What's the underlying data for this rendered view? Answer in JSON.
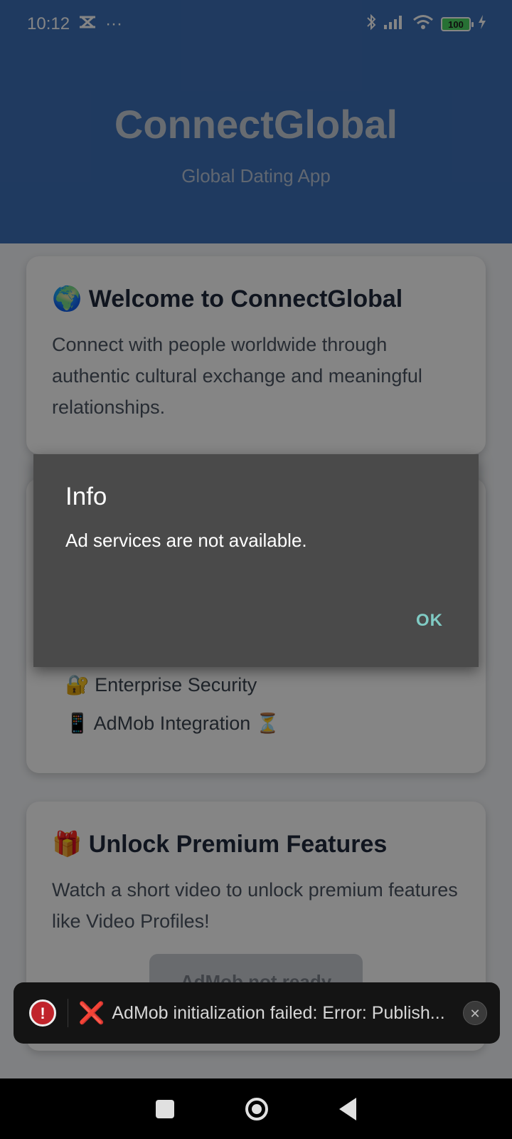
{
  "status_bar": {
    "time": "10:12",
    "battery": "100",
    "icons": [
      "notification-icon",
      "more-dots-icon",
      "bluetooth-icon",
      "signal-icon",
      "wifi-icon",
      "battery-icon",
      "charging-icon"
    ]
  },
  "header": {
    "title": "ConnectGlobal",
    "subtitle": "Global Dating App"
  },
  "welcome_card": {
    "emoji": "🌍",
    "title": "Welcome to ConnectGlobal",
    "text": "Connect with people worldwide through authentic cultural exchange and meaningful relationships."
  },
  "features_card": {
    "items": [
      {
        "emoji": "🔐",
        "label": "Enterprise Security",
        "suffix": ""
      },
      {
        "emoji": "📱",
        "label": "AdMob Integration",
        "suffix": "⏳"
      }
    ]
  },
  "premium_card": {
    "emoji": "🎁",
    "title": "Unlock Premium Features",
    "text": "Watch a short video to unlock premium features like Video Profiles!",
    "button_label": "AdMob not ready"
  },
  "dialog": {
    "title": "Info",
    "message": "Ad services are not available.",
    "ok_label": "OK"
  },
  "toast": {
    "icon_text": "!",
    "x_glyph": "❌",
    "message": "AdMob initialization failed: Error: Publish..."
  },
  "colors": {
    "header_bg": "#3d70b8",
    "dialog_bg": "#4a4a4a",
    "ok_accent": "#80cbc4",
    "toast_bg": "#141414",
    "error_red": "#c0242b"
  }
}
